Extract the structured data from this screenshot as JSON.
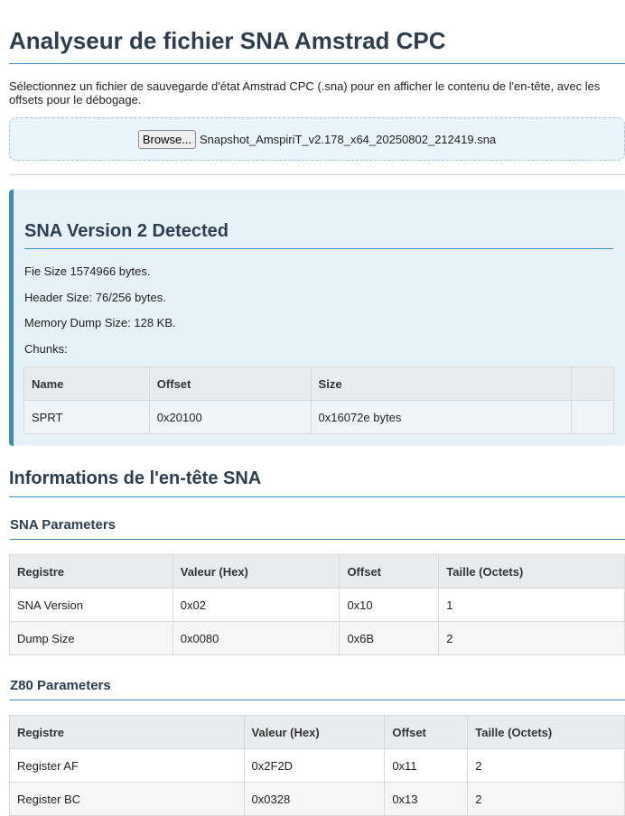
{
  "page": {
    "title": "Analyseur de fichier SNA Amstrad CPC",
    "intro": "Sélectionnez un fichier de sauvegarde d'état Amstrad CPC (.sna) pour en afficher le contenu de l'en-tête, avec les offsets pour le débogage."
  },
  "file_input": {
    "button_label": "Browse...",
    "file_name": "Snapshot_AmspiriT_v2.178_x64_20250802_212419.sna"
  },
  "detection": {
    "title": "SNA Version 2 Detected",
    "file_size": "Fie Size 1574966 bytes.",
    "header_size": "Header Size: 76/256 bytes.",
    "memory_dump_size": "Memory Dump Size: 128 KB.",
    "chunks_label": "Chunks:",
    "chunks_headers": [
      "Name",
      "Offset",
      "Size",
      ""
    ],
    "chunks_rows": [
      [
        "SPRT",
        "0x20100",
        "0x16072e bytes",
        ""
      ]
    ]
  },
  "header_info": {
    "title": "Informations de l'en-tête SNA",
    "sna_params": {
      "title": "SNA Parameters",
      "headers": [
        "Registre",
        "Valeur (Hex)",
        "Offset",
        "Taille (Octets)"
      ],
      "rows": [
        [
          "SNA Version",
          "0x02",
          "0x10",
          "1"
        ],
        [
          "Dump Size",
          "0x0080",
          "0x6B",
          "2"
        ]
      ]
    },
    "z80_params": {
      "title": "Z80 Parameters",
      "headers": [
        "Registre",
        "Valeur (Hex)",
        "Offset",
        "Taille (Octets)"
      ],
      "rows": [
        [
          "Register AF",
          "0x2F2D",
          "0x11",
          "2"
        ],
        [
          "Register BC",
          "0x0328",
          "0x13",
          "2"
        ]
      ]
    }
  },
  "colors": {
    "accent": "#3c8dbc",
    "heading": "#2c3e50",
    "panel_bg": "#e6f1f8"
  }
}
